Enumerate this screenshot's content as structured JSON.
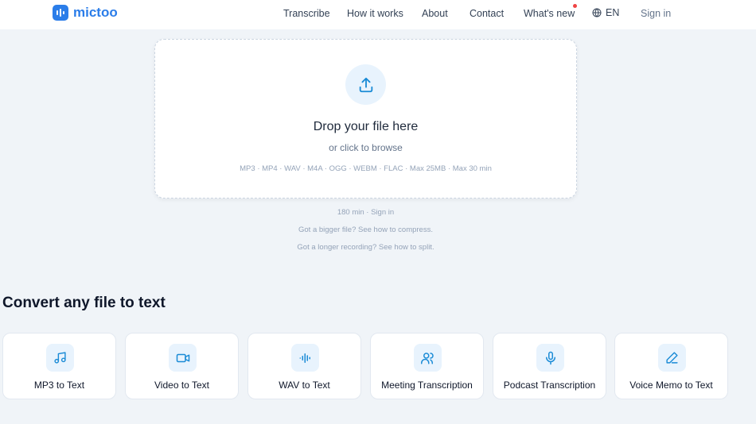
{
  "colors": {
    "accent": "#2b7de9",
    "background": "#f0f4f8",
    "notification_dot": "#ef4444",
    "icon_bg": "#e8f3fd"
  },
  "header": {
    "logo_text": "mictoo",
    "nav": [
      {
        "label": "Transcribe"
      },
      {
        "label": "How it works"
      },
      {
        "label": "About"
      },
      {
        "label": "Contact"
      },
      {
        "label": "What's new",
        "has_notification_dot": true
      }
    ],
    "language": {
      "icon": "globe-icon",
      "label": "EN"
    },
    "signin": "Sign in"
  },
  "dropzone": {
    "icon": "upload-icon",
    "title": "Drop your file here",
    "subtitle": "or click to browse",
    "formats": "MP3 · MP4 · WAV · M4A · OGG · WEBM · FLAC  ·  Max 25MB  ·  Max 30 min"
  },
  "below": {
    "limit": "180 min · Sign in",
    "compress": "Got a bigger file? See how to compress.",
    "split": "Got a longer recording? See how to split."
  },
  "section": {
    "title": "Convert any file to text",
    "cards": [
      {
        "label": "MP3 to Text",
        "icon": "music-note-icon"
      },
      {
        "label": "Video to Text",
        "icon": "video-camera-icon"
      },
      {
        "label": "WAV to Text",
        "icon": "audio-wave-icon"
      },
      {
        "label": "Meeting Transcription",
        "icon": "users-icon"
      },
      {
        "label": "Podcast Transcription",
        "icon": "microphone-icon"
      },
      {
        "label": "Voice Memo to Text",
        "icon": "pen-icon"
      }
    ]
  }
}
